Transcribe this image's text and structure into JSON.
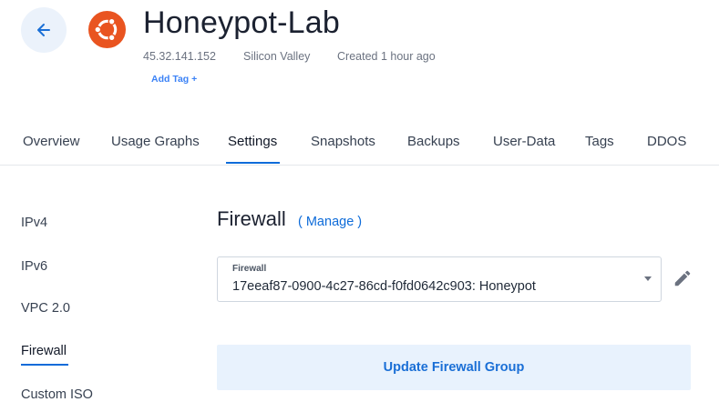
{
  "header": {
    "title": "Honeypot-Lab",
    "ip": "45.32.141.152",
    "location": "Silicon Valley",
    "created": "Created 1 hour ago",
    "add_tag": "Add Tag +",
    "back_icon": "arrow-left-icon",
    "os_icon": "ubuntu-logo-icon",
    "os_color": "#e95420"
  },
  "tabs": [
    {
      "label": "Overview"
    },
    {
      "label": "Usage Graphs"
    },
    {
      "label": "Settings",
      "active": true
    },
    {
      "label": "Snapshots"
    },
    {
      "label": "Backups"
    },
    {
      "label": "User-Data"
    },
    {
      "label": "Tags"
    },
    {
      "label": "DDOS"
    }
  ],
  "sidebar": {
    "items": [
      {
        "label": "IPv4"
      },
      {
        "label": "IPv6"
      },
      {
        "label": "VPC 2.0"
      },
      {
        "label": "Firewall",
        "active": true
      },
      {
        "label": "Custom ISO"
      }
    ]
  },
  "firewall": {
    "title": "Firewall",
    "manage_label": "( Manage )",
    "select_label": "Firewall",
    "select_value": "17eeaf87-0900-4c27-86cd-f0fd0642c903: Honeypot",
    "edit_icon": "pencil-icon",
    "update_button": "Update Firewall Group"
  },
  "colors": {
    "accent": "#0d6bd9",
    "button_bg": "#e8f2fd"
  }
}
